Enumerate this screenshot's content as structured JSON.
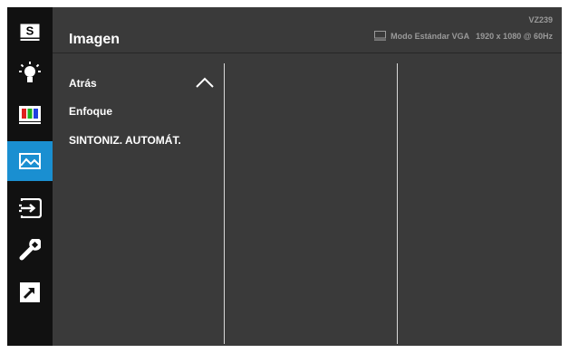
{
  "header": {
    "title": "Imagen",
    "model": "VZ239",
    "mode": "Modo Estándar VGA",
    "resolution": "1920 x 1080 @ 60Hz",
    "mode_icon": "monitor-icon"
  },
  "sidebar": {
    "items": [
      {
        "name": "splendid-icon",
        "label": "S"
      },
      {
        "name": "brightness-icon"
      },
      {
        "name": "color-icon"
      },
      {
        "name": "image-icon",
        "active": true
      },
      {
        "name": "input-select-icon"
      },
      {
        "name": "system-setup-icon"
      },
      {
        "name": "shortcut-icon"
      }
    ]
  },
  "menu": {
    "items": [
      {
        "label": "Atrás",
        "icon": "chevron-up-icon"
      },
      {
        "label": "Enfoque"
      },
      {
        "label": "SINTONIZ. AUTOMÁT."
      }
    ]
  },
  "colors": {
    "active": "#1a8fd1",
    "sidebar": "#111111",
    "panel": "#3a3a3a",
    "text": "#ffffff",
    "status_text": "#9a9a9a"
  }
}
